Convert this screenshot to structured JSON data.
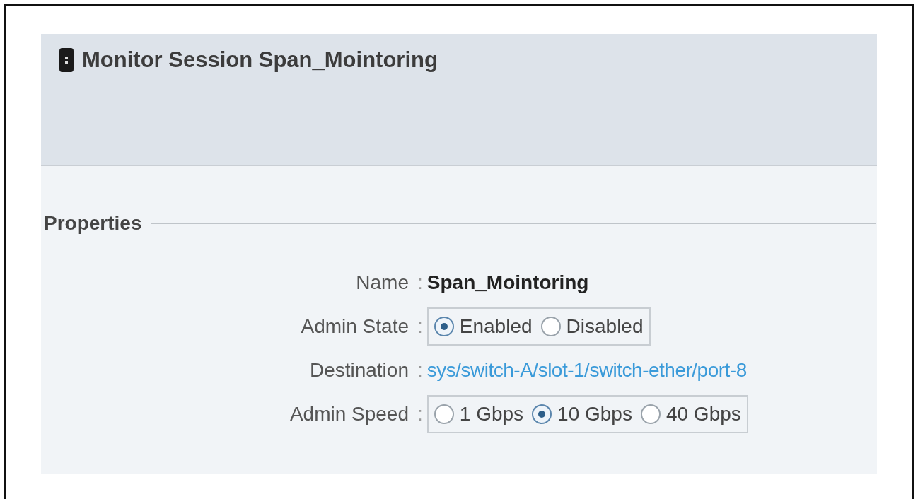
{
  "header": {
    "title": "Monitor Session Span_Mointoring"
  },
  "section": {
    "title": "Properties"
  },
  "fields": [
    {
      "kind": "text",
      "label": "Name",
      "colon": ":",
      "value": "Span_Mointoring"
    },
    {
      "kind": "radio",
      "label": "Admin State",
      "colon": ":",
      "options": [
        {
          "label": "Enabled",
          "selected": true
        },
        {
          "label": "Disabled",
          "selected": false
        }
      ]
    },
    {
      "kind": "link",
      "label": "Destination",
      "colon": ":",
      "value": "sys/switch-A/slot-1/switch-ether/port-8"
    },
    {
      "kind": "radio",
      "label": "Admin Speed",
      "colon": ":",
      "options": [
        {
          "label": "1 Gbps",
          "selected": false
        },
        {
          "label": "10 Gbps",
          "selected": true
        },
        {
          "label": "40 Gbps",
          "selected": false
        }
      ]
    }
  ]
}
